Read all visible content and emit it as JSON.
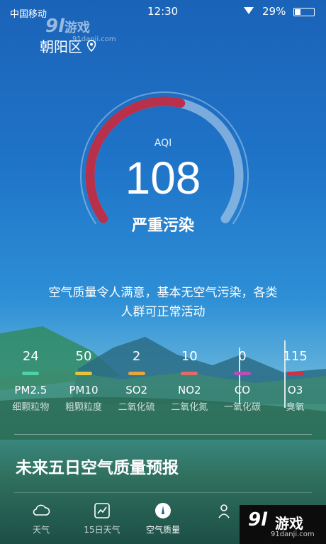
{
  "status": {
    "carrier": "中国移动",
    "time": "12:30",
    "battery": "29%",
    "battery_level": 0.29
  },
  "watermark": {
    "logo_num": "9l",
    "logo_text": "游戏",
    "site": "91danji.com"
  },
  "location": {
    "name": "朝阳区",
    "icon": "location-pin-icon"
  },
  "aqi": {
    "label": "AQI",
    "value": "108",
    "level": "严重污染",
    "gauge_fraction": 0.55,
    "fill_color": "#b8304a"
  },
  "description": {
    "line1": "空气质量令人满意，基本无空气污染，各类",
    "line2": "人群可正常活动"
  },
  "pollutants": [
    {
      "value": "24",
      "code": "PM2.5",
      "name": "细颗粒物",
      "color": "#4fd1a5"
    },
    {
      "value": "50",
      "code": "PM10",
      "name": "粗颗粒度",
      "color": "#e6c43a"
    },
    {
      "value": "2",
      "code": "SO2",
      "name": "二氧化硫",
      "color": "#e8a63a"
    },
    {
      "value": "10",
      "code": "NO2",
      "name": "二氧化氮",
      "color": "#e06b6b"
    },
    {
      "value": "0",
      "code": "CO",
      "name": "一氧化碳",
      "color": "#b84fb8"
    },
    {
      "value": "115",
      "code": "O3",
      "name": "臭氧",
      "color": "#c8334a"
    }
  ],
  "forecast": {
    "title": "未来五日空气质量预报"
  },
  "tabs": [
    {
      "label": "天气",
      "icon": "cloud-icon"
    },
    {
      "label": "15日天气",
      "icon": "trend-chart-icon"
    },
    {
      "label": "空气质量",
      "icon": "air-quality-icon",
      "active": true
    },
    {
      "label": "",
      "icon": "tab-icon"
    }
  ]
}
